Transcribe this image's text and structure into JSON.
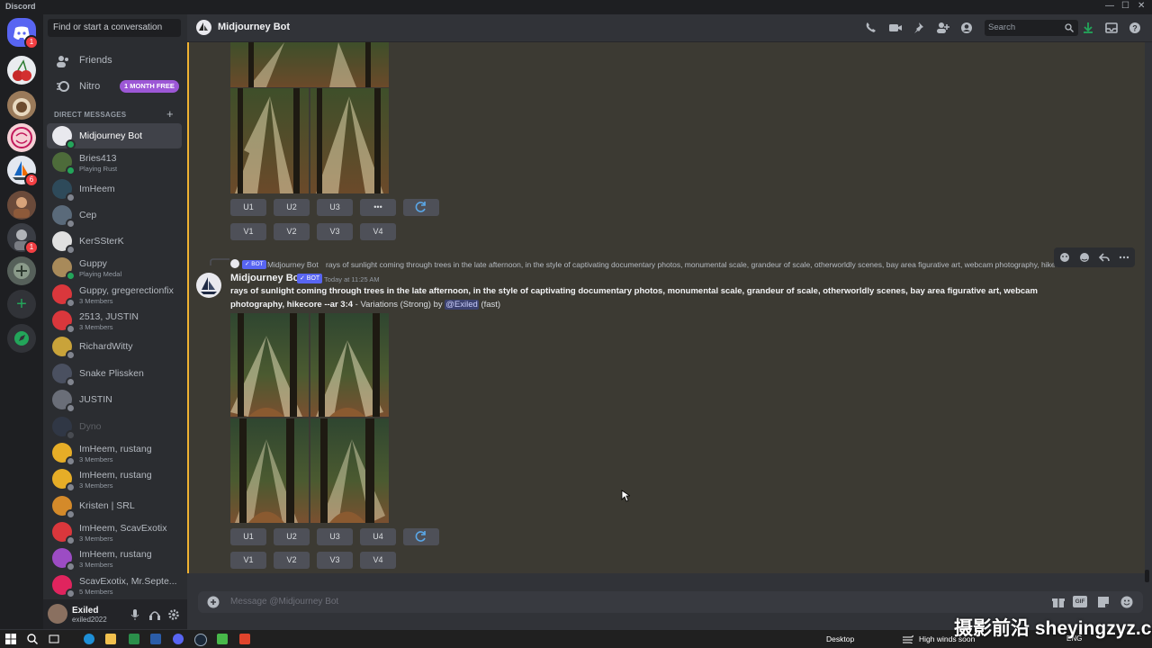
{
  "window": {
    "app_name": "Discord",
    "minimize": "—",
    "maximize": "☐",
    "close": "✕"
  },
  "servers": {
    "home_badge": "1",
    "s5_badge": "6",
    "s7_badge": "1",
    "add_symbol": "+",
    "explore_symbol": "➜"
  },
  "sidebar": {
    "search_placeholder": "Find or start a conversation",
    "friends_label": "Friends",
    "nitro_label": "Nitro",
    "nitro_badge": "1 MONTH FREE",
    "dm_header": "DIRECT MESSAGES",
    "dm_add": "+",
    "dms": [
      {
        "name": "Midjourney Bot",
        "sub": "",
        "color": "#e9e9ee"
      },
      {
        "name": "Bries413",
        "sub": "Playing Rust",
        "color": "#4d6b3a"
      },
      {
        "name": "ImHeem",
        "sub": "",
        "color": "#2e4a5a"
      },
      {
        "name": "Cep",
        "sub": "",
        "color": "#5a6a7a"
      },
      {
        "name": "KerSSterK",
        "sub": "",
        "color": "#e0e0e0"
      },
      {
        "name": "Guppy",
        "sub": "Playing Medal",
        "color": "#a88a5a"
      },
      {
        "name": "Guppy, gregerectionfix",
        "sub": "3 Members",
        "color": "#da373c"
      },
      {
        "name": "2513, JUSTIN",
        "sub": "3 Members",
        "color": "#da373c"
      },
      {
        "name": "RichardWitty",
        "sub": "",
        "color": "#c9a33a"
      },
      {
        "name": "Snake Plissken",
        "sub": "",
        "color": "#4a5060"
      },
      {
        "name": "JUSTIN",
        "sub": "",
        "color": "#6a6e78"
      },
      {
        "name": "Dyno",
        "sub": "",
        "color": "#3a4a6a"
      },
      {
        "name": "ImHeem, rustang",
        "sub": "3 Members",
        "color": "#e6ad27"
      },
      {
        "name": "ImHeem, rustang",
        "sub": "3 Members",
        "color": "#e6ad27"
      },
      {
        "name": "Kristen | SRL",
        "sub": "",
        "color": "#d48a2a"
      },
      {
        "name": "ImHeem, ScavExotix",
        "sub": "3 Members",
        "color": "#da373c"
      },
      {
        "name": "ImHeem, rustang",
        "sub": "3 Members",
        "color": "#9c4cc4"
      },
      {
        "name": "ScavExotix, Mr.Septe...",
        "sub": "5 Members",
        "color": "#e0245e"
      }
    ]
  },
  "user": {
    "name": "Exiled",
    "tag": "exiled2022"
  },
  "header": {
    "channel_name": "Midjourney Bot",
    "search_placeholder": "Search"
  },
  "messages": {
    "first": {
      "buttons_u": [
        "U1",
        "U2",
        "U3",
        "•••"
      ],
      "buttons_v": [
        "V1",
        "V2",
        "V3",
        "V4"
      ]
    },
    "second": {
      "reply_author": "Midjourney Bot",
      "reply_bot": "✓ BOT",
      "reply_text": "rays of sunlight coming through trees in the late afternoon, in the style of captivating documentary photos, monumental scale, grandeur of scale, otherworldly scenes, bay area figurative art, webcam photography, hikecore",
      "author": "Midjourney Bot",
      "bot_tag": "✓ BOT",
      "time": "Today at 11:25 AM",
      "prompt": "rays of sunlight coming through trees in the late afternoon, in the style of captivating documentary photos, monumental scale, grandeur of scale, otherworldly scenes, bay area figurative art, webcam photography, hikecore --ar 3:4",
      "suffix": " - Variations (Strong) by ",
      "mention": "@Exiled",
      "speed": " (fast)",
      "buttons_u": [
        "U1",
        "U2",
        "U3",
        "U4"
      ],
      "buttons_v": [
        "V1",
        "V2",
        "V3",
        "V4"
      ]
    }
  },
  "composer": {
    "placeholder": "Message @Midjourney Bot",
    "gif_label": "GIF"
  },
  "taskbar": {
    "desktop_label": "Desktop",
    "weather_text": "High winds soon",
    "lang": "ENG"
  },
  "watermark": "摄影前沿 sheyingzyz.com",
  "colors": {
    "accent": "#5865f2",
    "online": "#23a55a",
    "bg_chat": "#313338",
    "bg_sidebar": "#2b2d31",
    "mention_bg": "#3c4270"
  }
}
